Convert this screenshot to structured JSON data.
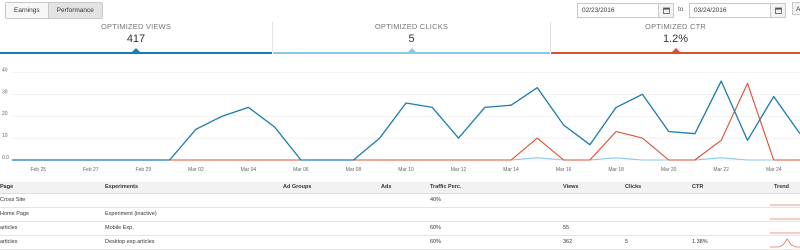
{
  "toolbar": {
    "tabs": [
      {
        "label": "Earnings",
        "active": false
      },
      {
        "label": "Performance",
        "active": true
      }
    ],
    "date_from": "02/23/2016",
    "date_to": "03/24/2016",
    "to_label": "to",
    "edge_button": "A"
  },
  "stats": [
    {
      "label": "OPTIMIZED VIEWS",
      "value": "417",
      "color": "#1a7cae"
    },
    {
      "label": "OPTIMIZED CLICKS",
      "value": "5",
      "color": "#8ac8e8"
    },
    {
      "label": "OPTIMIZED CTR",
      "value": "1.2%",
      "color": "#d94f30"
    }
  ],
  "chart_data": {
    "type": "line",
    "x": [
      "Feb 24",
      "Feb 25",
      "Feb 26",
      "Feb 27",
      "Feb 28",
      "Feb 29",
      "Mar 01",
      "Mar 02",
      "Mar 03",
      "Mar 04",
      "Mar 05",
      "Mar 06",
      "Mar 07",
      "Mar 08",
      "Mar 09",
      "Mar 10",
      "Mar 11",
      "Mar 12",
      "Mar 13",
      "Mar 14",
      "Mar 15",
      "Mar 16",
      "Mar 17",
      "Mar 18",
      "Mar 19",
      "Mar 20",
      "Mar 21",
      "Mar 22",
      "Mar 23",
      "Mar 24",
      "Mar 25"
    ],
    "tick_labels": [
      "Feb 25",
      "Feb 27",
      "Feb 29",
      "Mar 02",
      "Mar 04",
      "Mar 06",
      "Mar 08",
      "Mar 10",
      "Mar 12",
      "Mar 14",
      "Mar 16",
      "Mar 18",
      "Mar 20",
      "Mar 22",
      "Mar 24"
    ],
    "yticks": [
      "0.0",
      "10",
      "20",
      "30",
      "40"
    ],
    "ylim": [
      0,
      42
    ],
    "grid": true,
    "series": [
      {
        "values": [
          0,
          0,
          0,
          0,
          0,
          0,
          0,
          14,
          20,
          24,
          15,
          0,
          0,
          0,
          10,
          26,
          24,
          10,
          24,
          25,
          33,
          16,
          7,
          24,
          30,
          13,
          12,
          36,
          9,
          29,
          12
        ],
        "color": "#1a7cae"
      },
      {
        "values": [
          0,
          0,
          0,
          0,
          0,
          0,
          0,
          0,
          0,
          0,
          0,
          0,
          0,
          0,
          0,
          0,
          0,
          0,
          0,
          0,
          10,
          0,
          0,
          13,
          10,
          0,
          0,
          9,
          35,
          0,
          0
        ],
        "color": "#d94f30"
      },
      {
        "values": [
          0,
          0,
          0,
          0,
          0,
          0,
          0,
          0,
          0,
          0,
          0,
          0,
          0,
          0,
          0,
          0,
          0,
          0,
          0,
          0,
          1,
          0,
          0,
          1,
          0,
          0,
          0,
          1,
          0,
          0,
          0
        ],
        "color": "#8ac8e8"
      }
    ]
  },
  "table": {
    "headers": [
      "Page",
      "Experiments",
      "Ad Groups",
      "Ads",
      "Traffic Perc.",
      "Views",
      "Clicks",
      "CTR",
      "Trend"
    ],
    "rows": [
      [
        "Cross Site",
        "",
        "",
        "",
        "40%",
        "",
        "",
        "",
        ""
      ],
      [
        "Home Page",
        "Experiment (inactive)",
        "",
        "",
        "",
        "",
        "",
        "",
        ""
      ],
      [
        "articles",
        "Mobile Exp.",
        "",
        "",
        "60%",
        "55",
        "",
        "",
        ""
      ],
      [
        "articles",
        "Desktop exp.articles",
        "",
        "",
        "60%",
        "362",
        "5",
        "1.38%",
        ""
      ]
    ],
    "trend_color": "#e07a5f",
    "trend_values": [
      [
        0,
        0,
        0,
        0,
        0,
        0,
        0,
        0
      ],
      [
        0,
        0,
        0,
        0,
        0,
        0,
        0,
        0
      ],
      [
        0,
        0,
        0,
        0,
        0,
        0,
        0,
        0
      ],
      [
        0,
        0,
        0,
        1,
        4,
        1,
        0,
        0
      ]
    ]
  }
}
